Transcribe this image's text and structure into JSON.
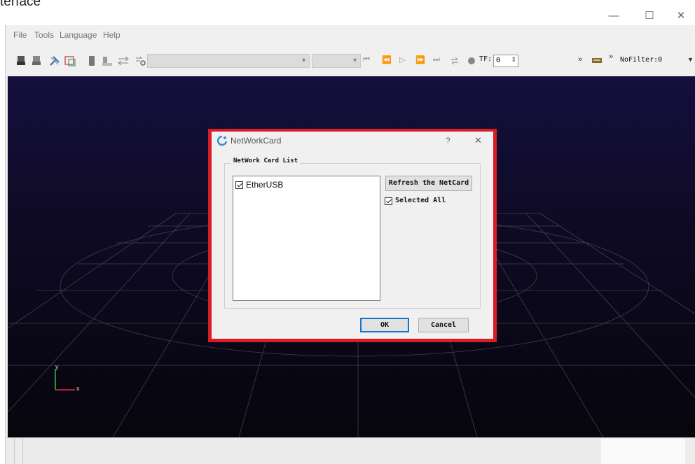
{
  "page": {
    "caption": "terface"
  },
  "window": {
    "minimize": "—",
    "maximize": "☐",
    "close": "✕"
  },
  "menu": [
    "File",
    "Tools",
    "Language",
    "Help"
  ],
  "toolbar": {
    "media_controls": [
      "⏮",
      "⏪",
      "▷",
      "⏩",
      "⏭"
    ],
    "tf_label": "TF:",
    "tf_value": "0",
    "more_1": "»",
    "more_2": "»",
    "filter_value": "NoFilter:0"
  },
  "axes": {
    "y": "y",
    "x": "x"
  },
  "dialog": {
    "title": "NetWorkCard",
    "help": "?",
    "close": "✕",
    "group_title": "NetWork Card List",
    "list": [
      {
        "label": "EtherUSB",
        "checked": true
      }
    ],
    "refresh_button": "Refresh the NetCard",
    "select_all": {
      "label": "Selected All",
      "checked": true
    },
    "ok_button": "OK",
    "cancel_button": "Cancel"
  },
  "colors": {
    "highlight_border": "#d71d26",
    "viewport_bg": "#140f3d"
  }
}
